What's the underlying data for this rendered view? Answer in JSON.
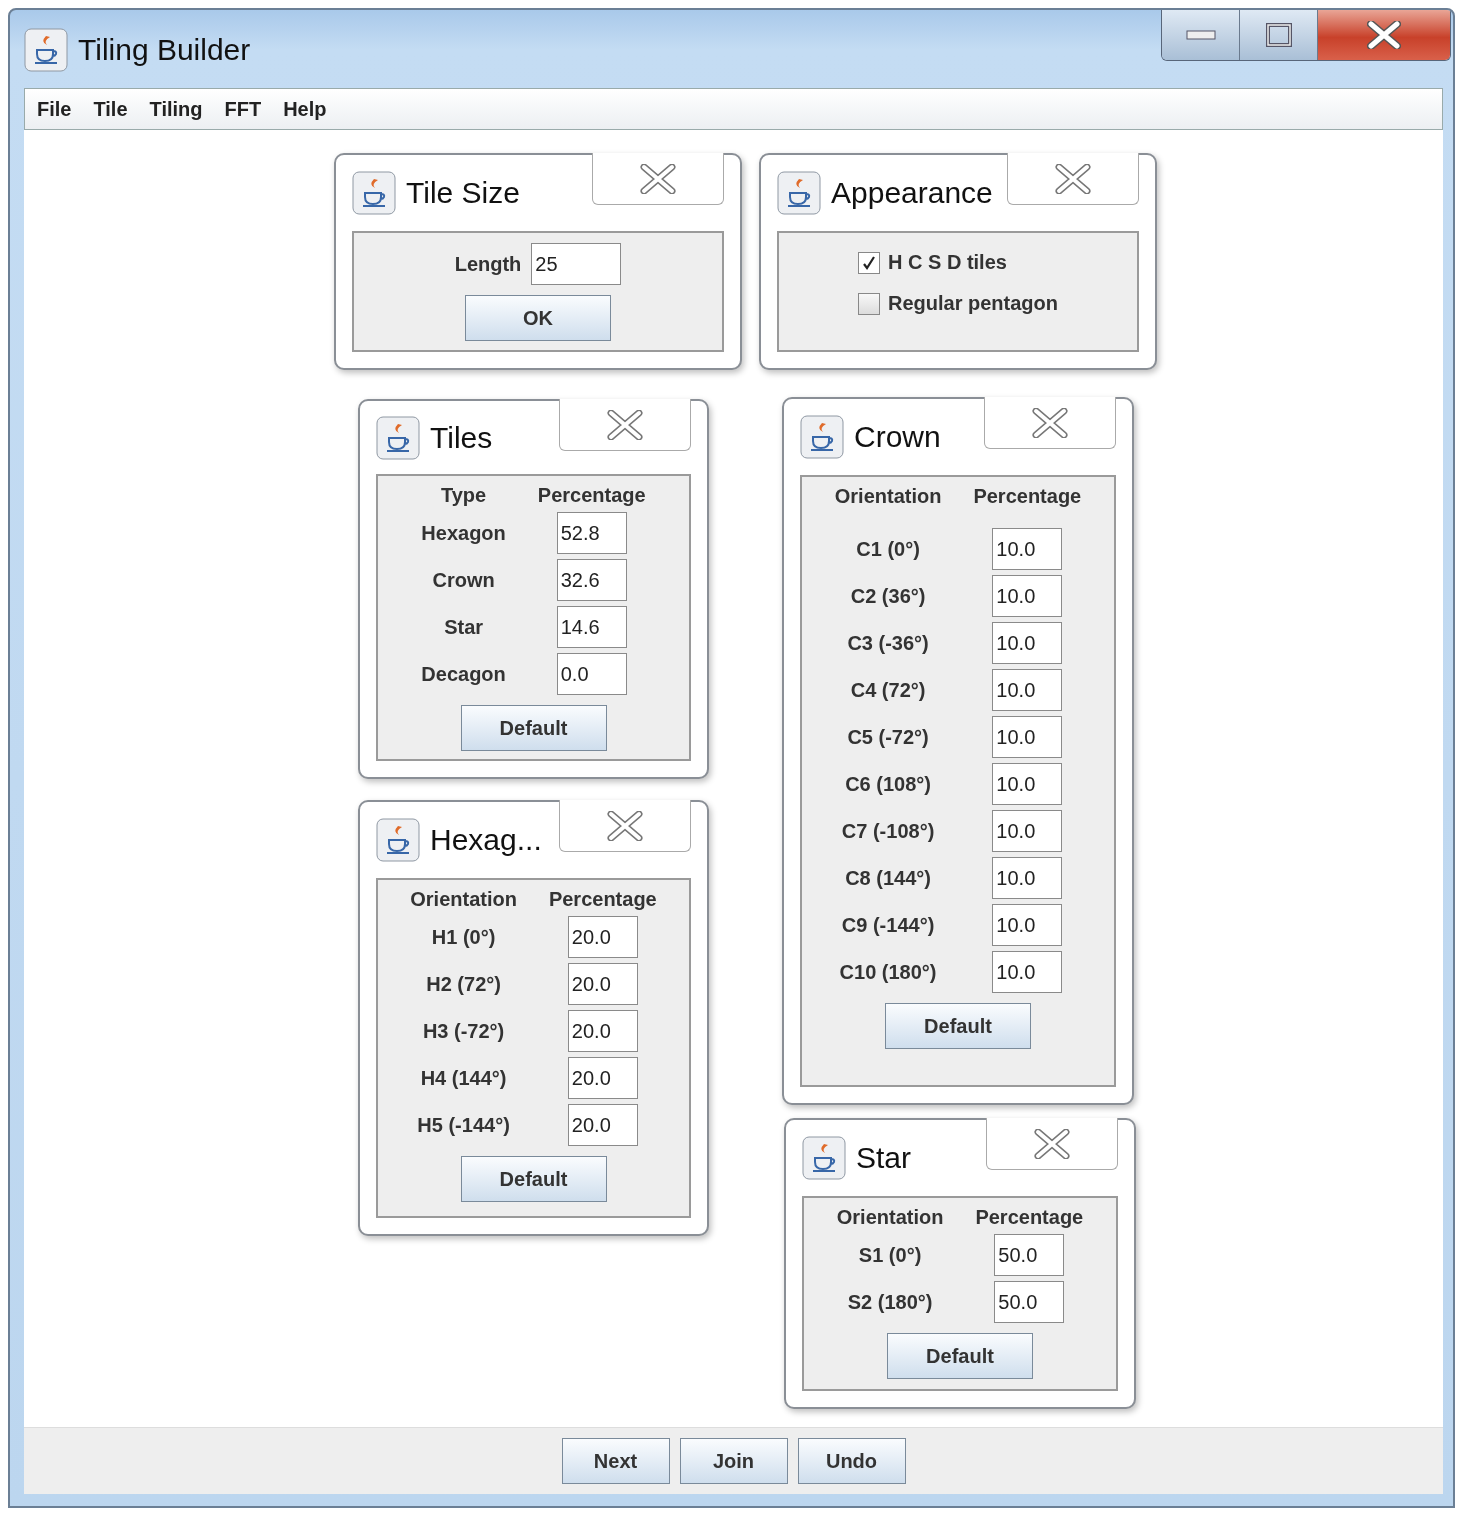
{
  "window": {
    "title": "Tiling Builder"
  },
  "menu": [
    "File",
    "Tile",
    "Tiling",
    "FFT",
    "Help"
  ],
  "frames": [
    {
      "kind": "length_form",
      "title": "Tile Size",
      "label": "Length",
      "value": "25",
      "button": "OK"
    },
    {
      "kind": "checkbox_list",
      "title": "Appearance",
      "options": [
        {
          "label": "H C S D tiles",
          "checked": true
        },
        {
          "label": "Regular pentagon",
          "checked": false
        }
      ]
    },
    {
      "kind": "percent_table",
      "title": "Tiles",
      "headers": [
        "Type",
        "Percentage"
      ],
      "rows": [
        {
          "label": "Hexagon",
          "value": "52.8"
        },
        {
          "label": "Crown",
          "value": "32.6"
        },
        {
          "label": "Star",
          "value": "14.6"
        },
        {
          "label": "Decagon",
          "value": "0.0"
        }
      ],
      "button": "Default"
    },
    {
      "kind": "percent_table",
      "title": "Crown",
      "headers": [
        "Orientation",
        "Percentage"
      ],
      "rows": [
        {
          "label": "C1 (0°)",
          "value": "10.0"
        },
        {
          "label": "C2 (36°)",
          "value": "10.0"
        },
        {
          "label": "C3 (-36°)",
          "value": "10.0"
        },
        {
          "label": "C4 (72°)",
          "value": "10.0"
        },
        {
          "label": "C5 (-72°)",
          "value": "10.0"
        },
        {
          "label": "C6 (108°)",
          "value": "10.0"
        },
        {
          "label": "C7 (-108°)",
          "value": "10.0"
        },
        {
          "label": "C8 (144°)",
          "value": "10.0"
        },
        {
          "label": "C9 (-144°)",
          "value": "10.0"
        },
        {
          "label": "C10 (180°)",
          "value": "10.0"
        }
      ],
      "button": "Default"
    },
    {
      "kind": "percent_table",
      "title": "Hexag...",
      "headers": [
        "Orientation",
        "Percentage"
      ],
      "rows": [
        {
          "label": "H1 (0°)",
          "value": "20.0"
        },
        {
          "label": "H2 (72°)",
          "value": "20.0"
        },
        {
          "label": "H3 (-72°)",
          "value": "20.0"
        },
        {
          "label": "H4 (144°)",
          "value": "20.0"
        },
        {
          "label": "H5 (-144°)",
          "value": "20.0"
        }
      ],
      "button": "Default"
    },
    {
      "kind": "percent_table",
      "title": "Star",
      "headers": [
        "Orientation",
        "Percentage"
      ],
      "rows": [
        {
          "label": "S1 (0°)",
          "value": "50.0"
        },
        {
          "label": "S2 (180°)",
          "value": "50.0"
        }
      ],
      "button": "Default"
    }
  ],
  "buttons": [
    "Next",
    "Join",
    "Undo"
  ]
}
